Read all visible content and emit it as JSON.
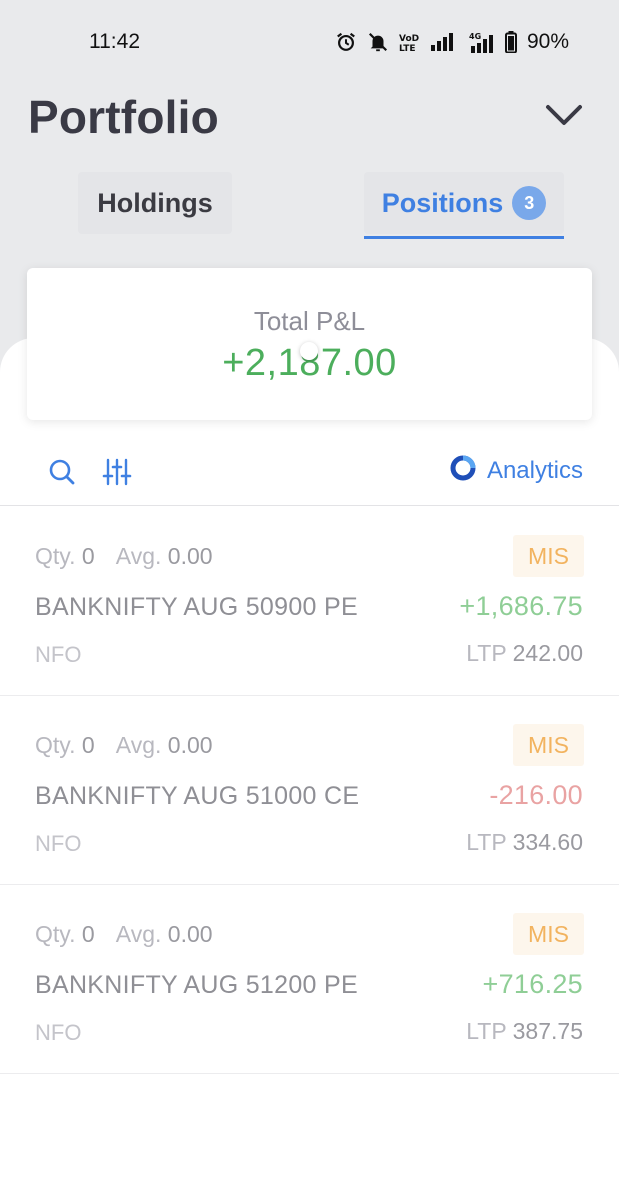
{
  "status_bar": {
    "time": "11:42",
    "network_label": "Vo) LTE",
    "battery": "90%"
  },
  "header": {
    "title": "Portfolio"
  },
  "tabs": {
    "holdings": "Holdings",
    "positions": "Positions",
    "positions_count": "3"
  },
  "summary": {
    "label": "Total P&L",
    "value": "+2,187.00"
  },
  "toolbar": {
    "analytics_label": "Analytics"
  },
  "labels": {
    "qty": "Qty.",
    "avg": "Avg.",
    "ltp": "LTP"
  },
  "positions": [
    {
      "qty": "0",
      "avg": "0.00",
      "product": "MIS",
      "instrument": "BANKNIFTY AUG 50900 PE",
      "pnl": "+1,686.75",
      "exchange": "NFO",
      "ltp": "242.00"
    },
    {
      "qty": "0",
      "avg": "0.00",
      "product": "MIS",
      "instrument": "BANKNIFTY AUG 51000 CE",
      "pnl": "-216.00",
      "exchange": "NFO",
      "ltp": "334.60"
    },
    {
      "qty": "0",
      "avg": "0.00",
      "product": "MIS",
      "instrument": "BANKNIFTY AUG 51200 PE",
      "pnl": "+716.25",
      "exchange": "NFO",
      "ltp": "387.75"
    }
  ],
  "colors": {
    "accent": "#3f80e2",
    "profit": "#4cae5c",
    "loss": "#e9a3a3",
    "product_badge": "#f2b35f"
  },
  "icons": {
    "chevron": "chevron-down-icon",
    "search": "search-icon",
    "filter": "filter-sliders-icon",
    "analytics": "analytics-ring-icon"
  }
}
